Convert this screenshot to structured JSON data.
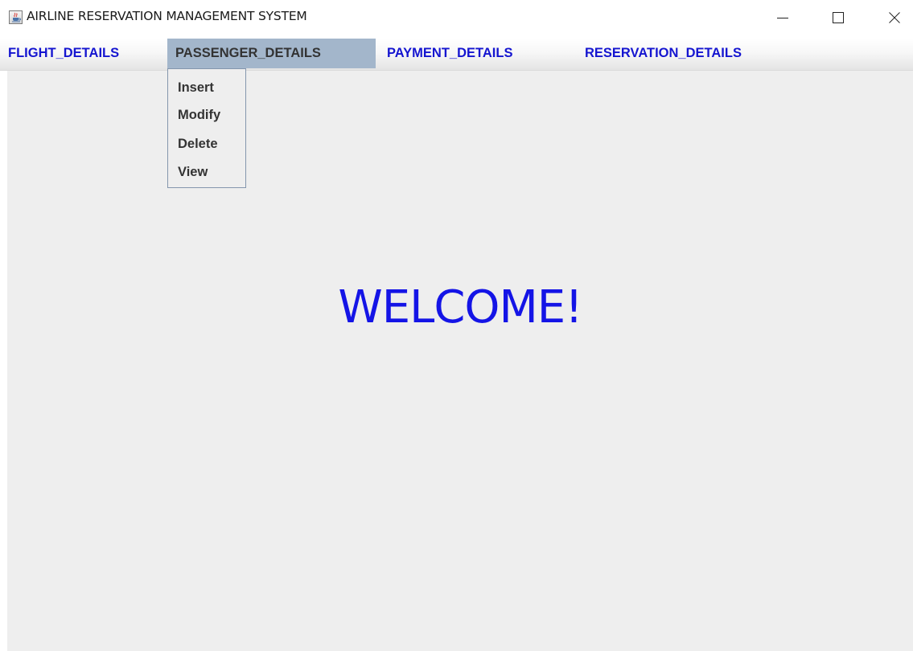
{
  "window": {
    "title": "AIRLINE RESERVATION MANAGEMENT SYSTEM"
  },
  "menubar": {
    "items": [
      {
        "label": "FLIGHT_DETAILS"
      },
      {
        "label": "PASSENGER_DETAILS"
      },
      {
        "label": "PAYMENT_DETAILS"
      },
      {
        "label": "RESERVATION_DETAILS"
      }
    ],
    "active_index": 1
  },
  "dropdown": {
    "items": [
      {
        "label": "Insert"
      },
      {
        "label": "Modify"
      },
      {
        "label": "Delete"
      },
      {
        "label": "View"
      }
    ]
  },
  "main": {
    "welcome_text": "WELCOME!"
  },
  "colors": {
    "menu_text": "#1515d0",
    "active_menu_bg": "#a3b6cb",
    "welcome_text": "#1414e6",
    "content_bg": "#eeeeee"
  },
  "icons": {
    "app": "java-cup-icon",
    "minimize": "minimize-icon",
    "maximize": "maximize-icon",
    "close": "close-icon"
  }
}
